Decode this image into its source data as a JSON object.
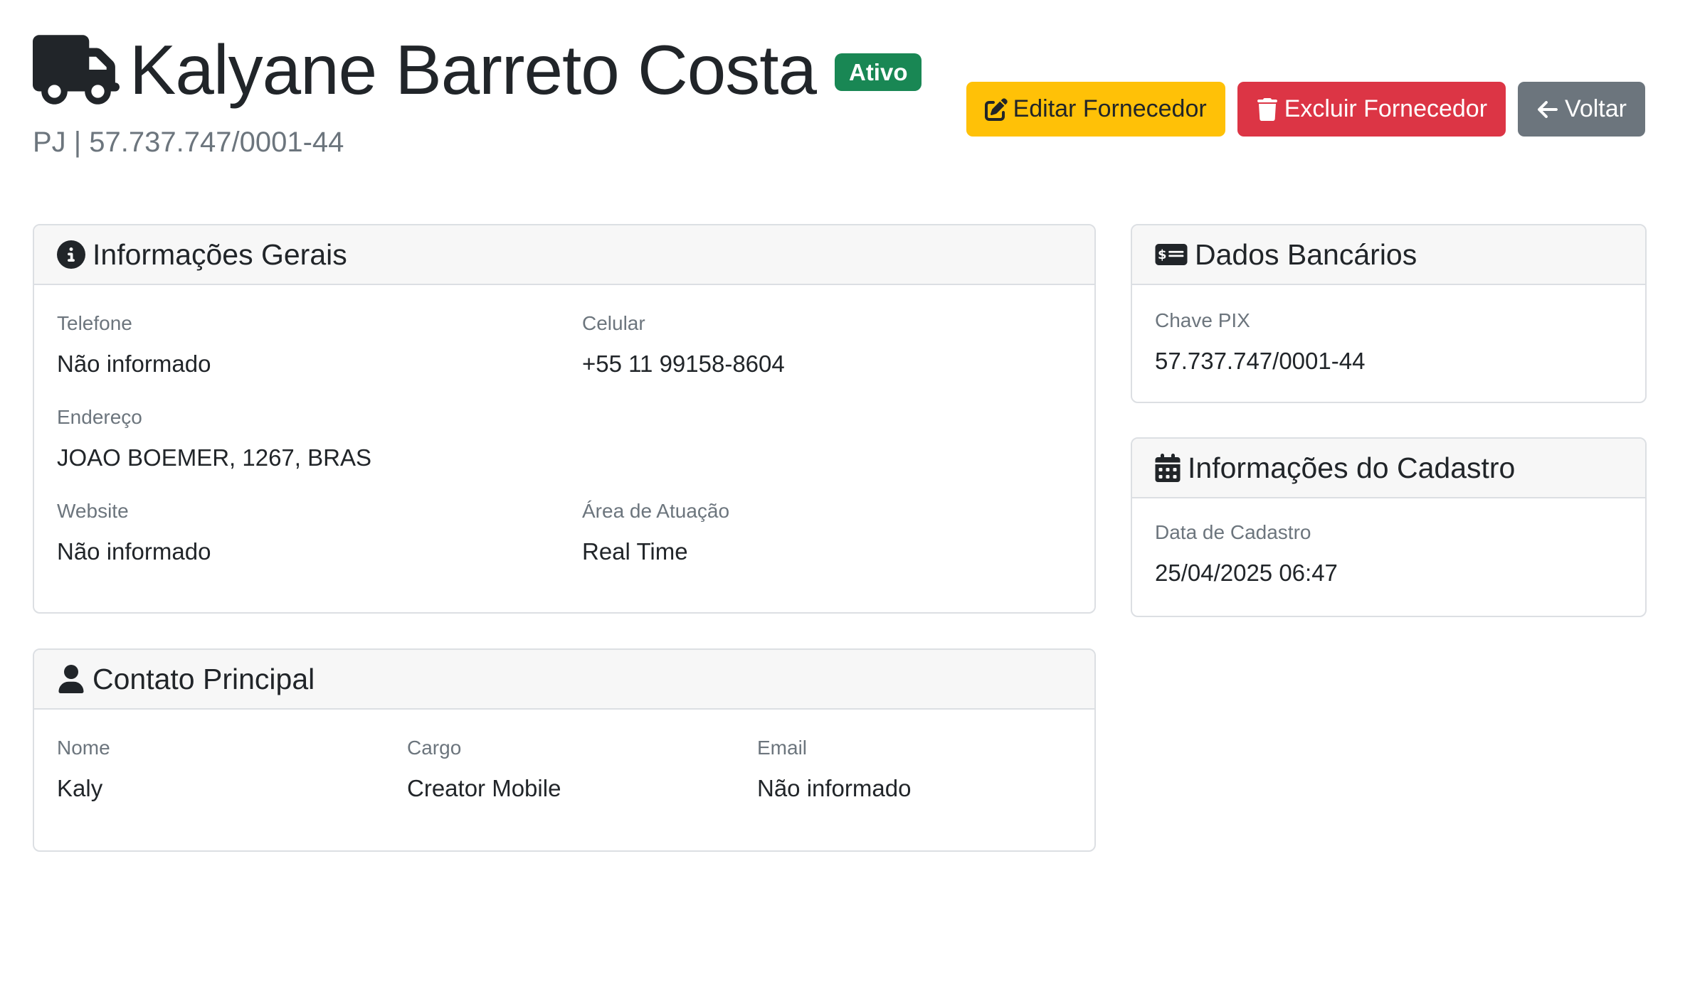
{
  "header": {
    "title": "Kalyane Barreto Costa",
    "status_badge": "Ativo",
    "subtitle": "PJ | 57.737.747/0001-44",
    "icon": "truck-icon"
  },
  "actions": {
    "edit_label": "Editar Fornecedor",
    "delete_label": "Excluir Fornecedor",
    "back_label": "Voltar"
  },
  "general_info": {
    "title": "Informações Gerais",
    "icon": "info-circle-icon",
    "fields": {
      "phone": {
        "label": "Telefone",
        "value": "Não informado"
      },
      "mobile": {
        "label": "Celular",
        "value": "+55 11 99158-8604"
      },
      "address": {
        "label": "Endereço",
        "value": "JOAO BOEMER, 1267, BRAS"
      },
      "website": {
        "label": "Website",
        "value": "Não informado"
      },
      "area": {
        "label": "Área de Atuação",
        "value": "Real Time"
      }
    }
  },
  "main_contact": {
    "title": "Contato Principal",
    "icon": "user-icon",
    "fields": {
      "name": {
        "label": "Nome",
        "value": "Kaly"
      },
      "role": {
        "label": "Cargo",
        "value": "Creator Mobile"
      },
      "email": {
        "label": "Email",
        "value": "Não informado"
      }
    }
  },
  "bank_data": {
    "title": "Dados Bancários",
    "icon": "money-check-icon",
    "fields": {
      "pix": {
        "label": "Chave PIX",
        "value": "57.737.747/0001-44"
      }
    }
  },
  "registration_info": {
    "title": "Informações do Cadastro",
    "icon": "calendar-icon",
    "fields": {
      "date": {
        "label": "Data de Cadastro",
        "value": "25/04/2025 06:47"
      }
    }
  },
  "colors": {
    "success": "#198754",
    "warning": "#ffc107",
    "danger": "#dc3545",
    "secondary": "#6c757d"
  }
}
